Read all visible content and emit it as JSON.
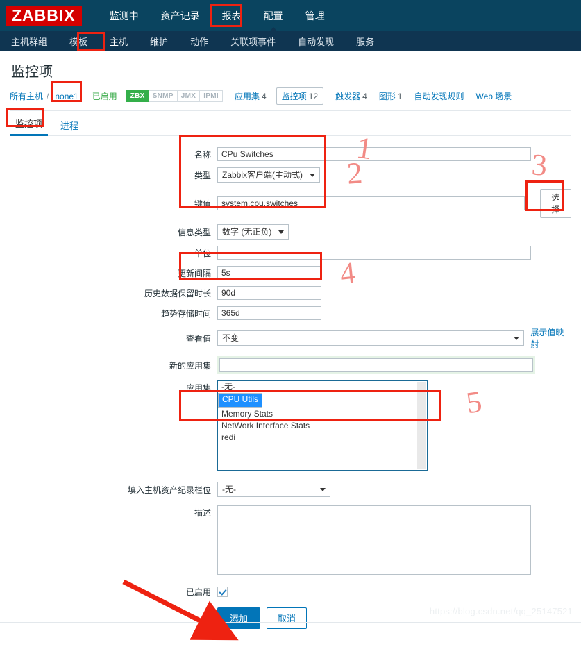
{
  "brand": {
    "logo": "ZABBIX"
  },
  "topnav": [
    {
      "label": "监测中",
      "active": false
    },
    {
      "label": "资产记录",
      "active": false
    },
    {
      "label": "报表",
      "active": false
    },
    {
      "label": "配置",
      "active": true
    },
    {
      "label": "管理",
      "active": false
    }
  ],
  "subnav": [
    {
      "label": "主机群组",
      "active": false
    },
    {
      "label": "模板",
      "active": false
    },
    {
      "label": "主机",
      "active": true
    },
    {
      "label": "维护",
      "active": false
    },
    {
      "label": "动作",
      "active": false
    },
    {
      "label": "关联项事件",
      "active": false
    },
    {
      "label": "自动发现",
      "active": false
    },
    {
      "label": "服务",
      "active": false
    }
  ],
  "page": {
    "title": "监控项"
  },
  "breadcrumb": {
    "all_hosts": "所有主机",
    "separator": "/",
    "host": "none1",
    "status": "已启用",
    "tags": [
      "ZBX",
      "SNMP",
      "JMX",
      "IPMI"
    ],
    "links": [
      {
        "label": "应用集",
        "count": "4",
        "boxed": false
      },
      {
        "label": "监控项",
        "count": "12",
        "boxed": true
      },
      {
        "label": "触发器",
        "count": "4",
        "boxed": false
      },
      {
        "label": "图形",
        "count": "1",
        "boxed": false
      },
      {
        "label": "自动发现规则",
        "count": "",
        "boxed": false
      },
      {
        "label": "Web 场景",
        "count": "",
        "boxed": false
      }
    ]
  },
  "tabs": [
    {
      "label": "监控项",
      "active": true
    },
    {
      "label": "进程",
      "active": false
    }
  ],
  "form": {
    "name": {
      "label": "名称",
      "value": "CPu Switches"
    },
    "type": {
      "label": "类型",
      "value": "Zabbix客户端(主动式)"
    },
    "key": {
      "label": "键值",
      "value": "system.cpu.switches",
      "select_button": "选择"
    },
    "info_type": {
      "label": "信息类型",
      "value": "数字 (无正负)"
    },
    "units": {
      "label": "单位",
      "value": ""
    },
    "update_interval": {
      "label": "更新间隔",
      "value": "5s"
    },
    "history": {
      "label": "历史数据保留时长",
      "value": "90d"
    },
    "trends": {
      "label": "趋势存储时间",
      "value": "365d"
    },
    "value_view": {
      "label": "查看值",
      "value": "不变",
      "link": "展示值映射"
    },
    "new_application": {
      "label": "新的应用集",
      "value": ""
    },
    "applications": {
      "label": "应用集",
      "options": [
        {
          "label": "-无-",
          "selected": false
        },
        {
          "label": "CPU Utils",
          "selected": true
        },
        {
          "label": "Memory Stats",
          "selected": false
        },
        {
          "label": "NetWork Interface Stats",
          "selected": false
        },
        {
          "label": "redi",
          "selected": false
        }
      ]
    },
    "inventory_field": {
      "label": "填入主机资产纪录栏位",
      "value": "-无-"
    },
    "description": {
      "label": "描述",
      "value": ""
    },
    "enabled": {
      "label": "已启用",
      "checked": true
    },
    "submit": "添加",
    "cancel": "取消"
  },
  "annotations": {
    "numbers": [
      "1",
      "2",
      "3",
      "4",
      "5"
    ]
  },
  "watermark": "https://blog.csdn.net/qq_25147521",
  "colors": {
    "header": "#0a445f",
    "subheader": "#0f3551",
    "brand_red": "#d40000",
    "link": "#0275b8",
    "enabled_green": "#3aab4a",
    "zbx_green": "#34af4a",
    "annotation_red": "#ee2211",
    "selection_blue": "#1e90ff"
  }
}
